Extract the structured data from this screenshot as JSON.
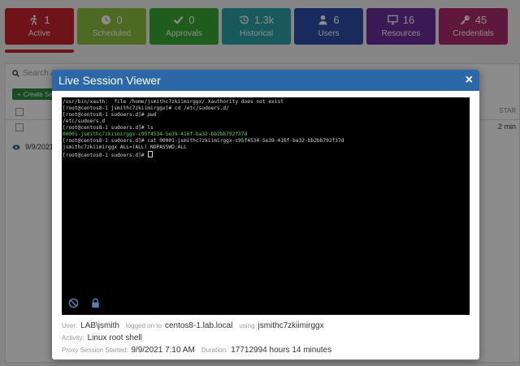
{
  "tiles": [
    {
      "icon": "running-person-icon",
      "count": "1",
      "label": "Active",
      "color": "#c8262e"
    },
    {
      "icon": "clock-icon",
      "count": "0",
      "label": "Scheduled",
      "color": "#8cbf3f"
    },
    {
      "icon": "checkmark-icon",
      "count": "0",
      "label": "Approvals",
      "color": "#3aaa35"
    },
    {
      "icon": "history-icon",
      "count": "1.3k",
      "label": "Historical",
      "color": "#2aa3a8"
    },
    {
      "icon": "user-icon",
      "count": "6",
      "label": "Users",
      "color": "#2f4fa8"
    },
    {
      "icon": "monitor-icon",
      "count": "16",
      "label": "Resources",
      "color": "#6c2e9a"
    },
    {
      "icon": "key-icon",
      "count": "45",
      "label": "Credentials",
      "color": "#b02a6e"
    }
  ],
  "background": {
    "search_placeholder": "Search A",
    "create_label": "Create Ses",
    "start_header": "STAR",
    "duration_value": "2 min",
    "date_value": "9/9/2021"
  },
  "modal": {
    "title": "Live Session Viewer",
    "close_label": "×",
    "terminal_lines": [
      {
        "text": "/usr/bin/xauth:  file /home/jsmithc7zkiimirggx/.Xauthority does not exist",
        "color": "normal"
      },
      {
        "text": "[root@centos8-1 jsmithc7zkiimirggx]# cd /etc/sudoers.d/",
        "color": "normal"
      },
      {
        "text": "[root@centos8-1 sudoers.d]# pwd",
        "color": "normal"
      },
      {
        "text": "/etc/sudoers.d",
        "color": "normal"
      },
      {
        "text": "[root@centos8-1 sudoers.d]# ls",
        "color": "normal"
      },
      {
        "text": "00001-jsmithc7zkiimirggx-c95f4534-5e39-416f-ba32-bb2bb792f37d",
        "color": "green"
      },
      {
        "text": "[root@centos8-1 sudoers.d]# cat 00001-jsmithc7zkiimirggx-c95f4534-5e39-416f-ba32-bb2bb792f37d",
        "color": "normal"
      },
      {
        "text": "jsmithc7zkiimirggx ALL=(ALL) NOPASSWD:ALL",
        "color": "normal"
      },
      {
        "text": "[root@centos8-1 sudoers.d]# ",
        "color": "normal",
        "cursor": true
      }
    ],
    "info": {
      "user_key": "User:",
      "user_value": "LAB\\jsmith",
      "logged_on_key": "logged on to",
      "host_value": "centos8-1.lab.local",
      "using_key": "using",
      "account_value": "jsmithc7zkiimirggx",
      "activity_key": "Activity:",
      "activity_value": "Linux root shell",
      "started_key": "Proxy Session Started:",
      "started_value": "9/9/2021 7:10 AM",
      "duration_key": "Duration:",
      "duration_value": "17712994 hours 14 minutes"
    }
  }
}
